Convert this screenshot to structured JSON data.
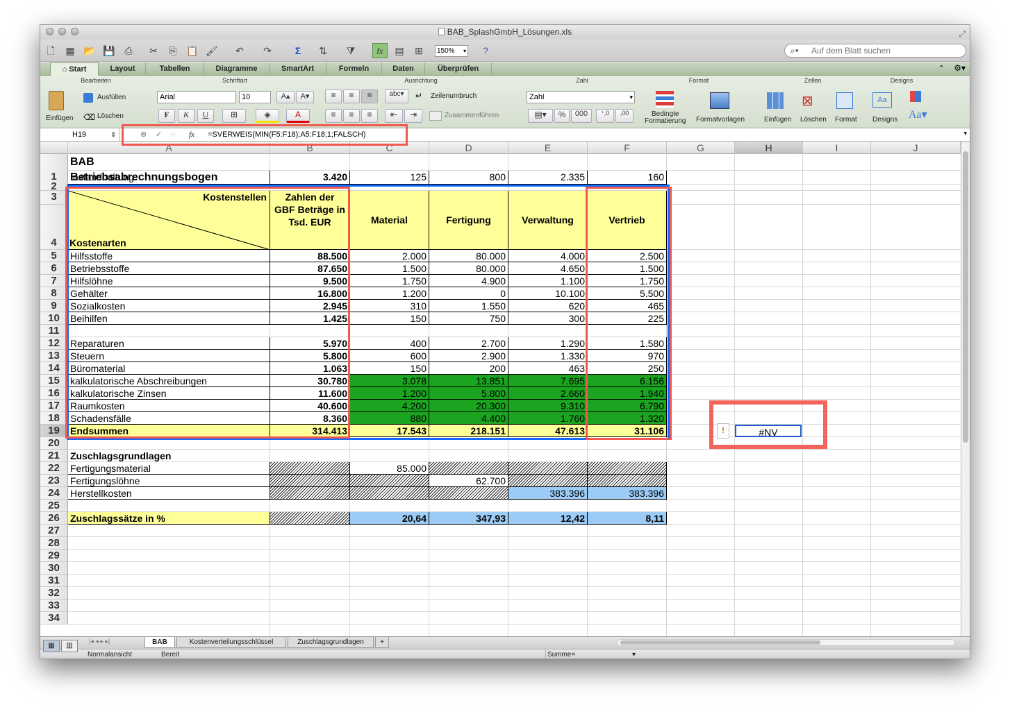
{
  "window": {
    "title": "BAB_SplashGmbH_Lösungen.xls"
  },
  "toolbar": {
    "zoom": "150%",
    "search_placeholder": "Auf dem Blatt suchen"
  },
  "ribbon_tabs": [
    "Start",
    "Layout",
    "Tabellen",
    "Diagramme",
    "SmartArt",
    "Formeln",
    "Daten",
    "Überprüfen"
  ],
  "ribbon": {
    "groups": [
      "Bearbeiten",
      "Schriftart",
      "Ausrichtung",
      "Zahl",
      "Format",
      "Zellen",
      "Designs"
    ],
    "einfuegen": "Einfügen",
    "ausfuellen": "Ausfüllen",
    "loeschen": "Löschen",
    "font": "Arial",
    "size": "10",
    "wrap": "Zeilenumbruch",
    "merge": "Zusammenführen",
    "number_format": "Zahl",
    "abc": "abc",
    "bedingte": "Bedingte",
    "formatierung": "Formatierung",
    "formatvorlagen": "Formatvorlagen",
    "zellen_einfuegen": "Einfügen",
    "zellen_loeschen": "Löschen",
    "zellen_format": "Format",
    "designs": "Designs"
  },
  "formula_bar": {
    "cell_ref": "H19",
    "fx": "fx",
    "formula": "=SVERWEIS(MIN(F5:F18);A5:F18;1;FALSCH)"
  },
  "columns": [
    "A",
    "B",
    "C",
    "D",
    "E",
    "F",
    "G",
    "H",
    "I",
    "J"
  ],
  "rows": [
    "1",
    "2",
    "3",
    "4",
    "5",
    "6",
    "7",
    "8",
    "9",
    "10",
    "11",
    "12",
    "13",
    "14",
    "15",
    "16",
    "17",
    "18",
    "19",
    "20",
    "21",
    "22",
    "23",
    "24",
    "25",
    "26",
    "27",
    "28",
    "29",
    "30",
    "31",
    "32",
    "33",
    "34"
  ],
  "sheet": {
    "title1": "BAB",
    "title2": "Betriebsabrechnungsbogen",
    "header_kostenstellen": "Kostenstellen",
    "header_kostenarten": "Kostenarten",
    "header_gbf": "Zahlen der GBF Beträge in Tsd. EUR",
    "header_cols": [
      "Material",
      "Fertigung",
      "Verwaltung",
      "Vertrieb"
    ],
    "table": [
      [
        "Hilfsstoffe",
        "88.500",
        "2.000",
        "80.000",
        "4.000",
        "2.500"
      ],
      [
        "Betriebsstoffe",
        "87.650",
        "1.500",
        "80.000",
        "4.650",
        "1.500"
      ],
      [
        "Hilfslöhne",
        "9.500",
        "1.750",
        "4.900",
        "1.100",
        "1.750"
      ],
      [
        "Gehälter",
        "16.800",
        "1.200",
        "0",
        "10.100",
        "5.500"
      ],
      [
        "Sozialkosten",
        "2.945",
        "310",
        "1.550",
        "620",
        "465"
      ],
      [
        "Beihilfen",
        "1.425",
        "150",
        "750",
        "300",
        "225"
      ],
      [
        "Instandhaltung",
        "3.420",
        "125",
        "800",
        "2.335",
        "160"
      ],
      [
        "Reparaturen",
        "5.970",
        "400",
        "2.700",
        "1.290",
        "1.580"
      ],
      [
        "Steuern",
        "5.800",
        "600",
        "2.900",
        "1.330",
        "970"
      ],
      [
        "Büromaterial",
        "1.063",
        "150",
        "200",
        "463",
        "250"
      ],
      [
        "kalkulatorische Abschreibungen",
        "30.780",
        "3.078",
        "13.851",
        "7.695",
        "6.156"
      ],
      [
        "kalkulatorische Zinsen",
        "11.600",
        "1.200",
        "5.800",
        "2.660",
        "1.940"
      ],
      [
        "Raumkosten",
        "40.600",
        "4.200",
        "20.300",
        "9.310",
        "6.790"
      ],
      [
        "Schadensfälle",
        "8.360",
        "880",
        "4.400",
        "1.760",
        "1.320"
      ]
    ],
    "totals": [
      "Endsummen",
      "314.413",
      "17.543",
      "218.151",
      "47.613",
      "31.106"
    ],
    "zuschlagsgrundlagen": "Zuschlagsgrundlagen",
    "fertigungsmaterial": "Fertigungsmaterial",
    "fertigungsmaterial_val": "85.000",
    "fertigungsloehne": "Fertigungslöhne",
    "fertigungsloehne_val": "62.700",
    "herstellkosten": "Herstellkosten",
    "herstellkosten_e": "383.396",
    "herstellkosten_f": "383.396",
    "zuschlagssaetze": "Zuschlagssätze in %",
    "saetze": [
      "20,64",
      "347,93",
      "12,42",
      "8,11"
    ],
    "h19": "#NV"
  },
  "sheet_tabs": [
    "BAB",
    "Kostenverteilungsschlüssel",
    "Zuschlagsgrundlagen"
  ],
  "status": {
    "view": "Normalansicht",
    "state": "Bereit",
    "sum": "Summe="
  },
  "colors": {
    "highlight_red": "#f0594f",
    "highlight_blue": "#1469ff",
    "green_cells": "#1aa41f",
    "blue_cells": "#9ccbf5",
    "yellow_cells": "#ffff9a"
  }
}
